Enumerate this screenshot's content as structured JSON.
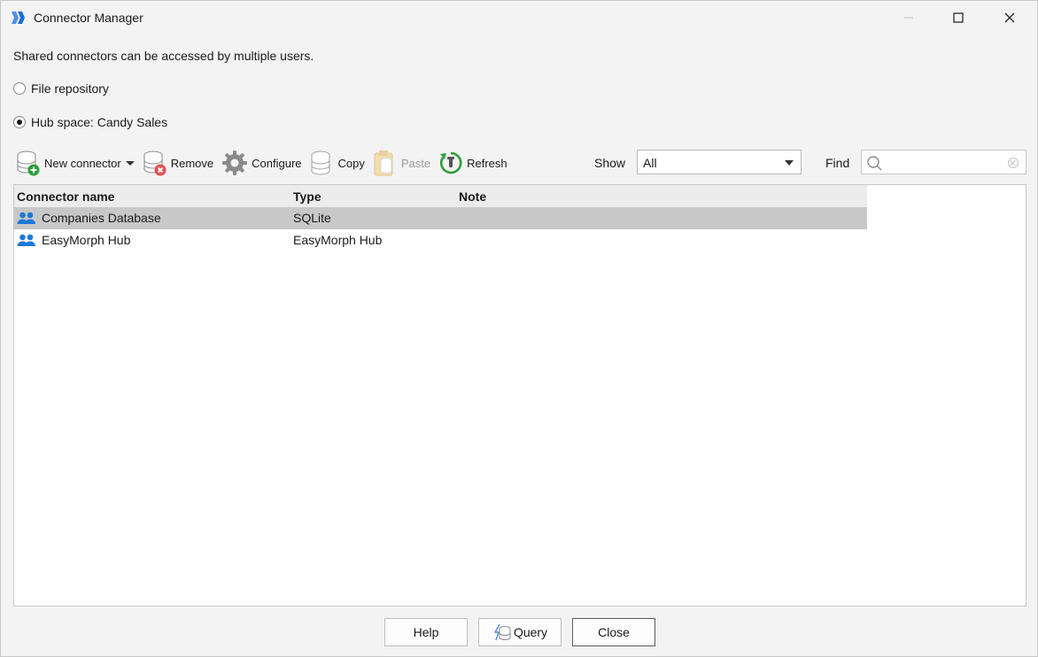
{
  "window": {
    "title": "Connector Manager"
  },
  "description": "Shared connectors can be accessed by multiple users.",
  "repository": {
    "options": [
      {
        "label": "File repository",
        "checked": false
      },
      {
        "label": "Hub space: Candy Sales",
        "checked": true
      }
    ]
  },
  "toolbar": {
    "new_connector": "New connector",
    "remove": "Remove",
    "configure": "Configure",
    "copy": "Copy",
    "paste": "Paste",
    "refresh": "Refresh"
  },
  "filter": {
    "show_label": "Show",
    "show_value": "All",
    "find_label": "Find",
    "find_value": "",
    "find_placeholder": ""
  },
  "grid": {
    "columns": [
      "Connector name",
      "Type",
      "Note"
    ],
    "rows": [
      {
        "name": "Companies Database",
        "type": "SQLite",
        "note": "",
        "selected": true
      },
      {
        "name": "EasyMorph Hub",
        "type": "EasyMorph Hub",
        "note": "",
        "selected": false
      }
    ]
  },
  "buttons": {
    "help": "Help",
    "query": "Query",
    "close": "Close"
  },
  "colors": {
    "accent": "#1e88e5",
    "selected_row": "#c8c8c8",
    "header_bg": "#ececec",
    "add_green": "#2e9e3c",
    "remove_red": "#e05050"
  },
  "icons": {
    "app": "easymorph-logo-icon",
    "new_connector": "database-add-icon",
    "remove": "database-remove-icon",
    "configure": "gear-icon",
    "copy": "database-copy-icon",
    "paste": "paste-icon",
    "refresh": "refresh-icon",
    "connector_row": "users-icon"
  }
}
